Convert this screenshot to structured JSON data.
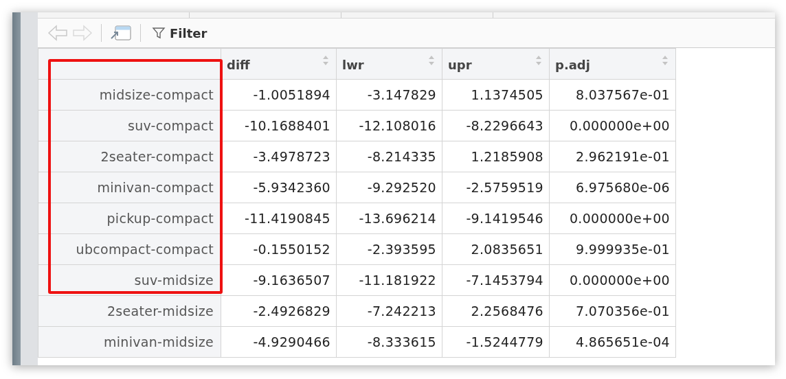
{
  "toolbar": {
    "back_disabled": true,
    "forward_disabled": true,
    "filter_label": "Filter"
  },
  "table": {
    "columns": [
      {},
      {
        "label": "diff"
      },
      {
        "label": "lwr"
      },
      {
        "label": "upr"
      },
      {
        "label": "p.adj"
      }
    ],
    "rows": [
      {
        "cells": [
          "midsize-compact",
          "-1.0051894",
          "-3.147829",
          "1.1374505",
          "8.037567e-01"
        ],
        "highlighted": true
      },
      {
        "cells": [
          "suv-compact",
          "-10.1688401",
          "-12.108016",
          "-8.2296643",
          "0.000000e+00"
        ],
        "highlighted": true
      },
      {
        "cells": [
          "2seater-compact",
          "-3.4978723",
          "-8.214335",
          "1.2185908",
          "2.962191e-01"
        ],
        "highlighted": true
      },
      {
        "cells": [
          "minivan-compact",
          "-5.9342360",
          "-9.292520",
          "-2.5759519",
          "6.975680e-06"
        ],
        "highlighted": true
      },
      {
        "cells": [
          "pickup-compact",
          "-11.4190845",
          "-13.696214",
          "-9.1419546",
          "0.000000e+00"
        ],
        "highlighted": true
      },
      {
        "cells": [
          "ubcompact-compact",
          "-0.1550152",
          "-2.393595",
          "2.0835651",
          "9.999935e-01"
        ],
        "highlighted": true
      },
      {
        "cells": [
          "suv-midsize",
          "-9.1636507",
          "-11.181922",
          "-7.1453794",
          "0.000000e+00"
        ],
        "highlighted": true
      },
      {
        "cells": [
          "2seater-midsize",
          "-2.4926829",
          "-7.242213",
          "2.2568476",
          "7.070356e-01"
        ],
        "highlighted": false
      },
      {
        "cells": [
          "minivan-midsize",
          "-4.9290466",
          "-8.333615",
          "-1.5244779",
          "4.865651e-04"
        ],
        "highlighted": false
      }
    ]
  }
}
